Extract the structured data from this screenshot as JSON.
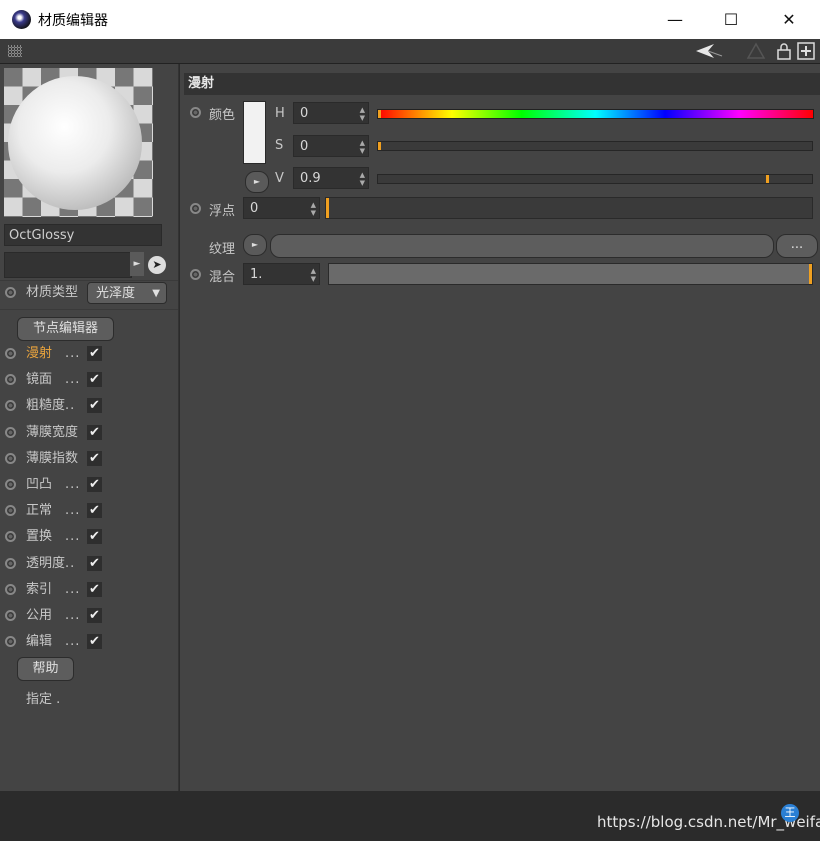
{
  "window": {
    "title": "材质编辑器",
    "min": "—",
    "max": "☐",
    "close": "✕"
  },
  "material": {
    "name": "OctGlossy",
    "type_label": "材质类型",
    "type_value": "光泽度",
    "node_editor": "节点编辑器"
  },
  "channels": [
    {
      "label": "漫射",
      "dots": "...",
      "checked": "✔",
      "active": true
    },
    {
      "label": "镜面",
      "dots": "...",
      "checked": "✔"
    },
    {
      "label": "粗糙度",
      "dots": "..",
      "checked": "✔"
    },
    {
      "label": "薄膜宽度",
      "dots": "",
      "checked": "✔"
    },
    {
      "label": "薄膜指数",
      "dots": "",
      "checked": "✔"
    },
    {
      "label": "凹凸",
      "dots": "...",
      "checked": "✔"
    },
    {
      "label": "正常",
      "dots": "...",
      "checked": "✔"
    },
    {
      "label": "置换",
      "dots": "...",
      "checked": "✔"
    },
    {
      "label": "透明度",
      "dots": "..",
      "checked": "✔"
    },
    {
      "label": "索引",
      "dots": "...",
      "checked": "✔"
    },
    {
      "label": "公用",
      "dots": "...",
      "checked": "✔"
    },
    {
      "label": "编辑",
      "dots": "...",
      "checked": "✔"
    }
  ],
  "help_button": "帮助",
  "assign_label": "指定",
  "assign_dots": ".",
  "section": {
    "title": "漫射"
  },
  "color": {
    "label": "颜色",
    "h_label": "H",
    "h_value": "0",
    "h_fraction": 0.0,
    "s_label": "S",
    "s_value": "0",
    "s_fraction": 0.0,
    "v_label": "V",
    "v_value": "0.9",
    "v_fraction": 0.9,
    "swatch_color": "#f2f2f2"
  },
  "float": {
    "label": "浮点",
    "value": "0",
    "fraction": 0.0
  },
  "texture": {
    "label": "纹理",
    "browse": "..."
  },
  "mix": {
    "label": "混合",
    "value": "1.",
    "fraction": 1.0
  },
  "accent_color": "#e8a33d",
  "watermark": {
    "text": "https://blog.csdn.net/Mr_weifai",
    "badge": "王"
  }
}
